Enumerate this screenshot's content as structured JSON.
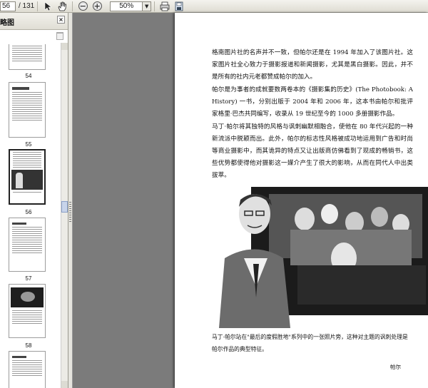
{
  "toolbar": {
    "current_page": "56",
    "total_pages": "/ 131",
    "zoom": "50%",
    "icons": [
      "select-arrow-icon",
      "hand-tool-icon",
      "zoom-out-icon",
      "zoom-in-icon",
      "print-icon",
      "save-icon"
    ],
    "zoom_out_glyph": "−",
    "zoom_in_glyph": "+",
    "dropdown_glyph": "▼"
  },
  "panel": {
    "title": "略图",
    "close_glyph": "×",
    "thumb_labels": [
      "54",
      "55",
      "56",
      "57",
      "58"
    ]
  },
  "page": {
    "para1": "格南图片社的名声并不一致，但帕尔还是在 1994 年加入了该图片社。这家图片社全心致力于摄影报道和新闻摄影，尤其是黑白摄影。因此，并不是所有的社内元老都赞成帕尔的加入。",
    "para2": "帕尔是为事者的成就要数两卷本的《摄影集的历史》(The Photobook: A History) 一书，分别出版于 2004 年和 2006 年，这本书由帕尔和批评家格里·巴杰共同编写，收录从 19 世纪至今的 1000 多册摄影作品。",
    "para3": "马丁·帕尔将其独特的风格与讽刺幽默相融合，使他在 80 年代兴起的一种新流派中脱颖而出。此外，帕尔的标志性风格被成功地运用到广告和时尚等商业摄影中，而其诡异的特点又让出版商仿佛看到了现成的畅销书，这些优势都使得他对摄影这一媒介产生了很大的影响，从而在同代人中出类拔萃。",
    "caption": "马丁·帕尔站在\"最后的度假胜地\"系列中的一张照片旁，这种对主题的讽刺处理是帕尔作品的典型特征。",
    "credit": "帕尔"
  }
}
